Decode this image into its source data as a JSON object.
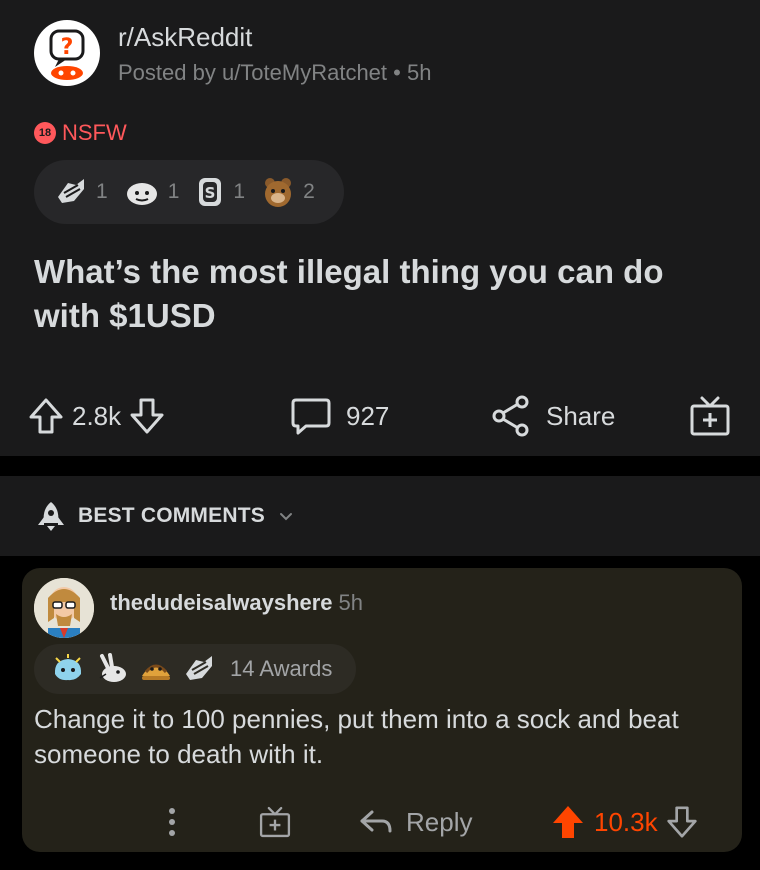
{
  "post": {
    "subreddit": "r/AskReddit",
    "byline": "Posted by u/ToteMyRatchet • 5h",
    "nsfw_badge": "18",
    "nsfw_label": "NSFW",
    "awards": [
      {
        "icon": "wholesome-seal-icon",
        "count": "1"
      },
      {
        "icon": "helpful-icon",
        "count": "1"
      },
      {
        "icon": "silver-coin-icon",
        "count": "1"
      },
      {
        "icon": "bear-icon",
        "count": "2"
      }
    ],
    "title": "What’s the most illegal thing you can do with $1USD",
    "score": "2.8k",
    "comments": "927",
    "share_label": "Share"
  },
  "sort": {
    "label": "BEST COMMENTS"
  },
  "comment": {
    "author": "thedudeisalwayshere",
    "time": "5h",
    "awards_label": "14 Awards",
    "award_icons": [
      "blob-icon",
      "rabbit-icon",
      "taco-icon",
      "wholesome-seal-icon"
    ],
    "body": "Change it to 100 pennies, put them into a sock and beat someone to death with it.",
    "reply_label": "Reply",
    "score": "10.3k"
  },
  "colors": {
    "upvote": "#ff4500",
    "nsfw": "#ff585b",
    "post_bg": "#1a1a1b",
    "comment_bg": "#242219"
  }
}
